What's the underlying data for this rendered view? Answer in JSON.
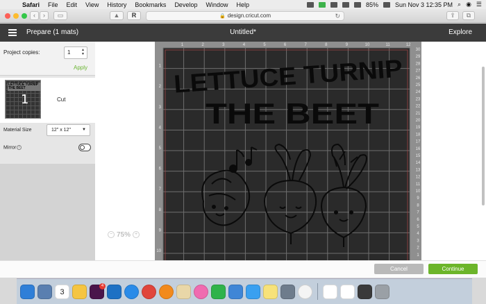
{
  "menubar": {
    "app": "Safari",
    "items": [
      "File",
      "Edit",
      "View",
      "History",
      "Bookmarks",
      "Develop",
      "Window",
      "Help"
    ],
    "battery": "85%",
    "datetime": "Sun Nov 3  12:35 PM"
  },
  "browser": {
    "url": "design.cricut.com"
  },
  "header": {
    "title": "Prepare (1 mats)",
    "document": "Untitled*",
    "explore": "Explore"
  },
  "panel": {
    "copies_label": "Project copies:",
    "copies_value": "1",
    "apply": "Apply",
    "mat_number": "1",
    "mat_thumb_text": "LETTUCE TURNIP THE BEET",
    "cut_label": "Cut",
    "mat_size_label": "Material Size",
    "mat_size_value": "12\" x 12\"",
    "mirror_label": "Mirror",
    "mirror_on": false
  },
  "canvas": {
    "design_line1": "LETTUCE TURNIP",
    "design_line2": "THE BEET",
    "zoom": "75%",
    "ruler_top": [
      "1",
      "2",
      "3",
      "4",
      "5",
      "6",
      "7",
      "8",
      "9",
      "10",
      "11",
      "12"
    ],
    "ruler_left": [
      "1",
      "2",
      "3",
      "4",
      "5",
      "6",
      "7",
      "8",
      "9",
      "10"
    ],
    "ruler_right": [
      "30",
      "29",
      "28",
      "27",
      "26",
      "25",
      "24",
      "23",
      "22",
      "21",
      "20",
      "19",
      "18",
      "17",
      "16",
      "15",
      "14",
      "13",
      "12",
      "11",
      "10",
      "9",
      "8",
      "7",
      "6",
      "5",
      "4",
      "3",
      "2",
      "1"
    ]
  },
  "footer": {
    "cancel": "Cancel",
    "continue": "Continue"
  },
  "dock": {
    "calendar_day": "3",
    "badge": "4",
    "icons": [
      "finder-icon",
      "preview-icon",
      "calendar-icon",
      "notes-icon",
      "slack-icon",
      "trello-icon",
      "safari-icon",
      "chrome-icon",
      "firefox-icon",
      "pencil-icon",
      "itunes-icon",
      "numbers-icon",
      "keynote-icon",
      "messages-icon",
      "stickies-icon",
      "photo-icon",
      "photos-icon",
      "document-icon",
      "textedit-icon",
      "files-icon",
      "trash-icon"
    ],
    "colors": [
      "#2f7fd8",
      "#5a7fb0",
      "#ffffff",
      "#f5c542",
      "#4a154b",
      "#1e71c4",
      "#2a8be8",
      "#e0453b",
      "#f28a1c",
      "#e9d7a8",
      "#f06bb0",
      "#2fb34a",
      "#3f86d6",
      "#3aa0f0",
      "#f7e27a",
      "#6e7c8c",
      "#f4f4f4",
      "#ffffff",
      "#ffffff",
      "#3a3a3a",
      "#9aa0a6"
    ]
  }
}
